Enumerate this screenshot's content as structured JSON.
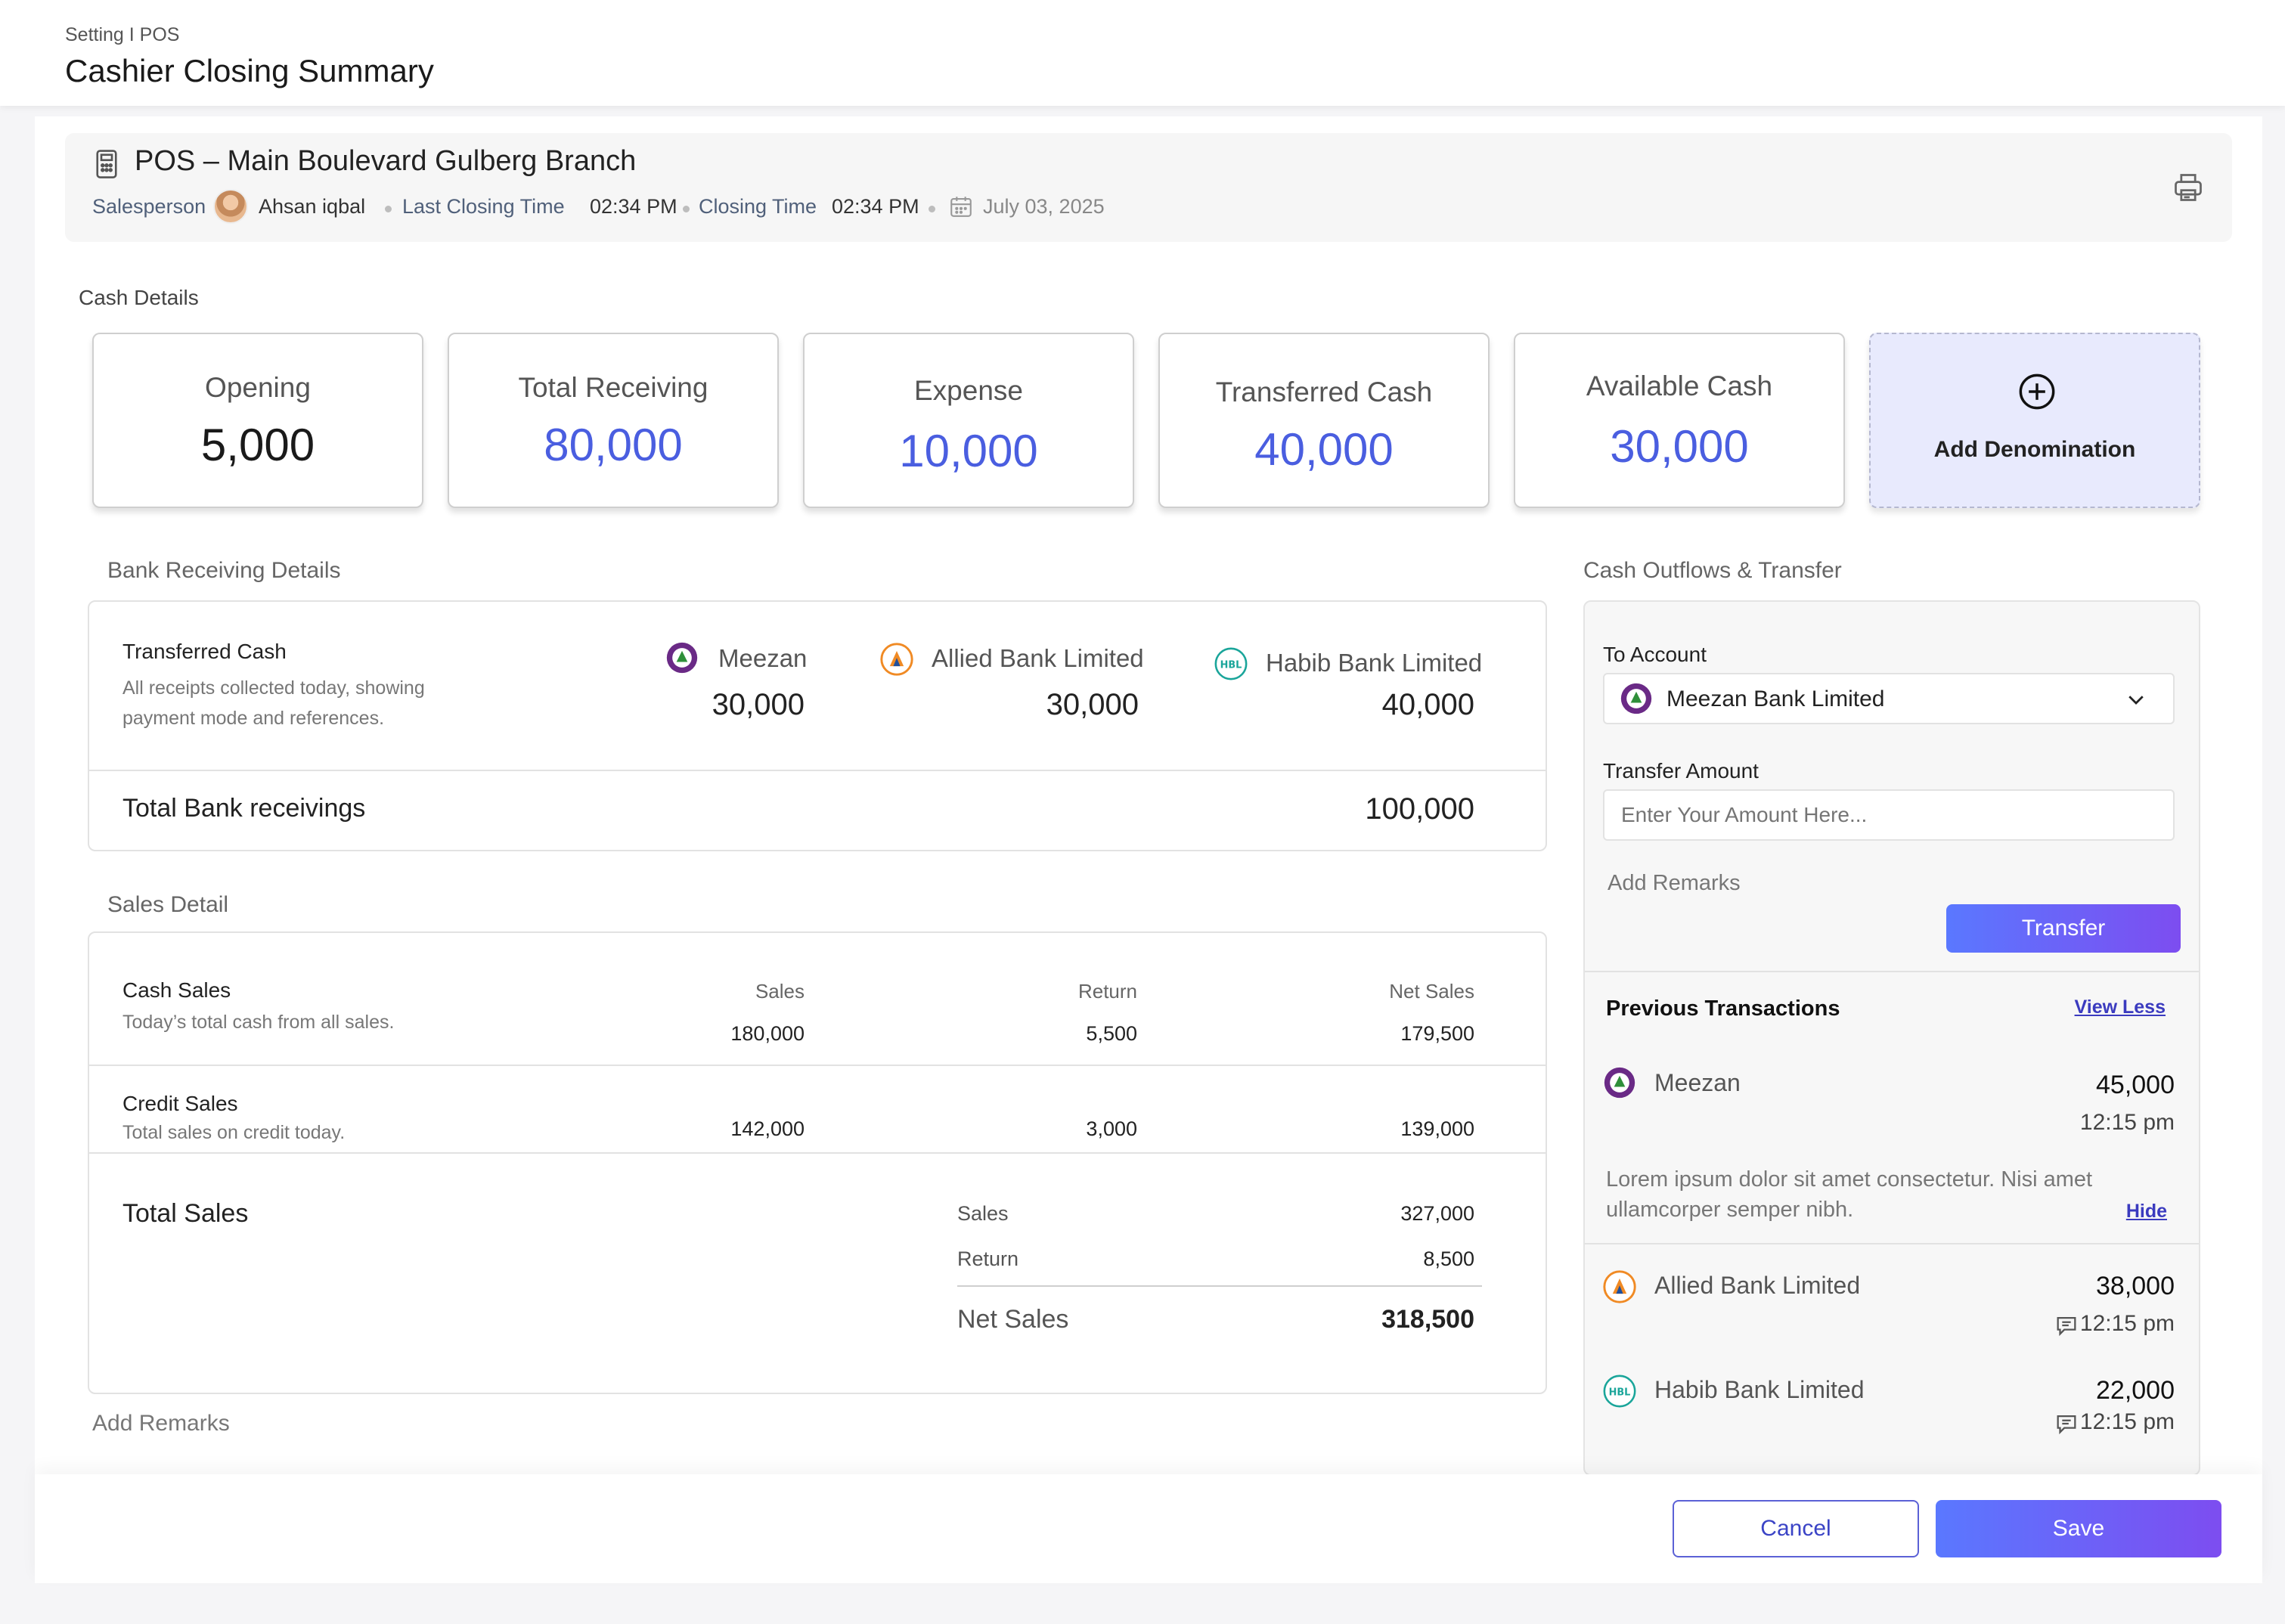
{
  "header": {
    "breadcrumb": "Setting I POS",
    "title": "Cashier Closing Summary"
  },
  "pos": {
    "title": "POS – Main Boulevard Gulberg Branch",
    "salesperson_label": "Salesperson",
    "salesperson": "Ahsan iqbal",
    "last_closing_label": "Last Closing Time",
    "last_closing_time": "02:34 PM",
    "closing_label": "Closing Time",
    "closing_time": "02:34 PM",
    "date": "July 03, 2025"
  },
  "cash_details": {
    "heading": "Cash Details",
    "cards": [
      {
        "label": "Opening",
        "value": "5,000"
      },
      {
        "label": "Total Receiving",
        "value": "80,000"
      },
      {
        "label": "Expense",
        "value": "10,000"
      },
      {
        "label": "Transferred Cash",
        "value": "40,000"
      },
      {
        "label": "Available Cash",
        "value": "30,000"
      }
    ],
    "add_denomination": "Add Denomination"
  },
  "bank_receiving": {
    "heading": "Bank Receiving Details",
    "title": "Transferred Cash",
    "desc_line1": "All receipts collected today, showing",
    "desc_line2": "payment mode and references.",
    "banks": [
      {
        "name": "Meezan",
        "amount": "30,000"
      },
      {
        "name": "Allied Bank Limited",
        "amount": "30,000"
      },
      {
        "name": "Habib Bank Limited",
        "amount": "40,000"
      }
    ],
    "total_label": "Total Bank receivings",
    "total_value": "100,000"
  },
  "sales_detail": {
    "heading": "Sales Detail",
    "cash_title": "Cash Sales",
    "cash_desc": "Today’s total cash from all sales.",
    "col_sales": "Sales",
    "col_return": "Return",
    "col_net": "Net Sales",
    "cash_sales": "180,000",
    "cash_return": "5,500",
    "cash_net": "179,500",
    "credit_title": "Credit Sales",
    "credit_desc": "Total sales on credit today.",
    "credit_sales": "142,000",
    "credit_return": "3,000",
    "credit_net": "139,000",
    "total_title": "Total Sales",
    "total_sales_label": "Sales",
    "total_sales": "327,000",
    "total_return_label": "Return",
    "total_return": "8,500",
    "total_net_label": "Net Sales",
    "total_net": "318,500"
  },
  "add_remarks_bottom": "Add Remarks",
  "outflows": {
    "heading": "Cash Outflows & Transfer",
    "to_account_label": "To Account",
    "to_account_value": "Meezan Bank Limited",
    "amount_label": "Transfer Amount",
    "amount_placeholder": "Enter Your Amount Here...",
    "remarks": "Add Remarks",
    "transfer_btn": "Transfer",
    "prev_title": "Previous Transactions",
    "view_less": "View Less",
    "transactions": [
      {
        "bank": "Meezan",
        "amount": "45,000",
        "time": "12:15 pm"
      },
      {
        "bank": "Allied Bank Limited",
        "amount": "38,000",
        "time": "12:15 pm"
      },
      {
        "bank": "Habib Bank Limited",
        "amount": "22,000",
        "time": "12:15 pm"
      }
    ],
    "remark_line1": "Lorem ipsum dolor sit amet consectetur. Nisi amet",
    "remark_line2": "ullamcorper semper nibh.",
    "hide": "Hide"
  },
  "footer": {
    "cancel": "Cancel",
    "save": "Save"
  },
  "colors": {
    "accent": "#4a5ee0",
    "gradient_start": "#5a78ff",
    "gradient_end": "#7d4df0"
  }
}
